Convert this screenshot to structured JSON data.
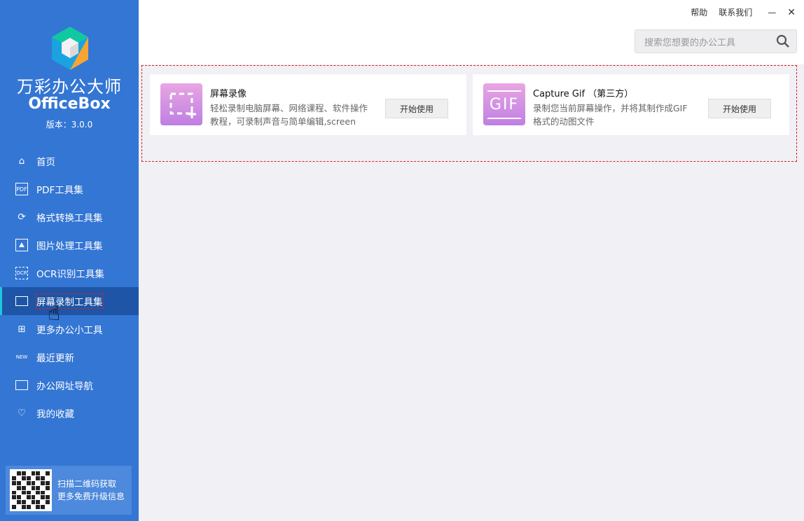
{
  "app": {
    "title": "万彩办公大师",
    "subtitle": "OfficeBox",
    "version": "版本：3.0.0"
  },
  "sidebar": {
    "items": [
      {
        "label": "首页",
        "icon": "home-icon"
      },
      {
        "label": "PDF工具集",
        "icon": "pdf-icon"
      },
      {
        "label": "格式转换工具集",
        "icon": "convert-icon"
      },
      {
        "label": "图片处理工具集",
        "icon": "image-icon"
      },
      {
        "label": "OCR识别工具集",
        "icon": "ocr-icon"
      },
      {
        "label": "屏幕录制工具集",
        "icon": "monitor-icon"
      },
      {
        "label": "更多办公小工具",
        "icon": "apps-icon"
      },
      {
        "label": "最近更新",
        "icon": "new-icon"
      },
      {
        "label": "办公网址导航",
        "icon": "browser-icon"
      },
      {
        "label": "我的收藏",
        "icon": "heart-icon"
      }
    ],
    "active": 5,
    "qr_text": [
      "扫描二维码获取",
      "更多免费升级信息"
    ]
  },
  "header": {
    "help": "帮助",
    "contact": "联系我们",
    "search_placeholder": "搜索您想要的办公工具"
  },
  "cards": [
    {
      "title": "屏幕录像",
      "desc": "轻松录制电脑屏幕、网络课程、软件操作教程，可录制声音与简单编辑,screen",
      "button": "开始使用"
    },
    {
      "title": "Capture Gif （第三方）",
      "desc": "录制您当前屏幕操作，并将其制作成GIF格式的动图文件",
      "button": "开始使用",
      "icon_text": "GIF"
    }
  ]
}
